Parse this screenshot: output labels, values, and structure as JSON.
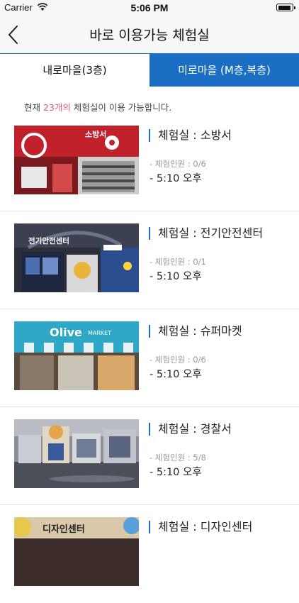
{
  "status_bar": {
    "carrier": "Carrier",
    "time": "5:06 PM"
  },
  "header": {
    "title": "바로 이용가능 체험실"
  },
  "tabs": [
    {
      "label": "내로마을(3층)",
      "active": false
    },
    {
      "label": "미로마을 (M층,복층)",
      "active": true
    }
  ],
  "info": {
    "prefix": "현재 ",
    "count": "23개의",
    "suffix": " 체험실이 이용 가능합니다."
  },
  "rooms": [
    {
      "name": "체험실 : 소방서",
      "capacity": "- 체험인원 : 0/6",
      "time": "- 5:10 오후",
      "sign": "소방서"
    },
    {
      "name": "체험실 : 전기안전센터",
      "capacity": "- 체험인원 : 0/1",
      "time": "- 5:10 오후",
      "sign": "전기안전센터"
    },
    {
      "name": "체험실 : 슈퍼마켓",
      "capacity": "- 체험인원 : 0/6",
      "time": "- 5:10 오후",
      "sign": "Olive",
      "sign2": "MARKET"
    },
    {
      "name": "체험실 : 경찰서",
      "capacity": "- 체험인원 : 5/8",
      "time": "- 5:10 오후",
      "sign": ""
    },
    {
      "name": "체험실 : 디자인센터",
      "capacity": "",
      "time": "",
      "sign": "디자인센터"
    }
  ],
  "colors": {
    "accent": "#1a6fc4",
    "highlight": "#e05d7a"
  }
}
